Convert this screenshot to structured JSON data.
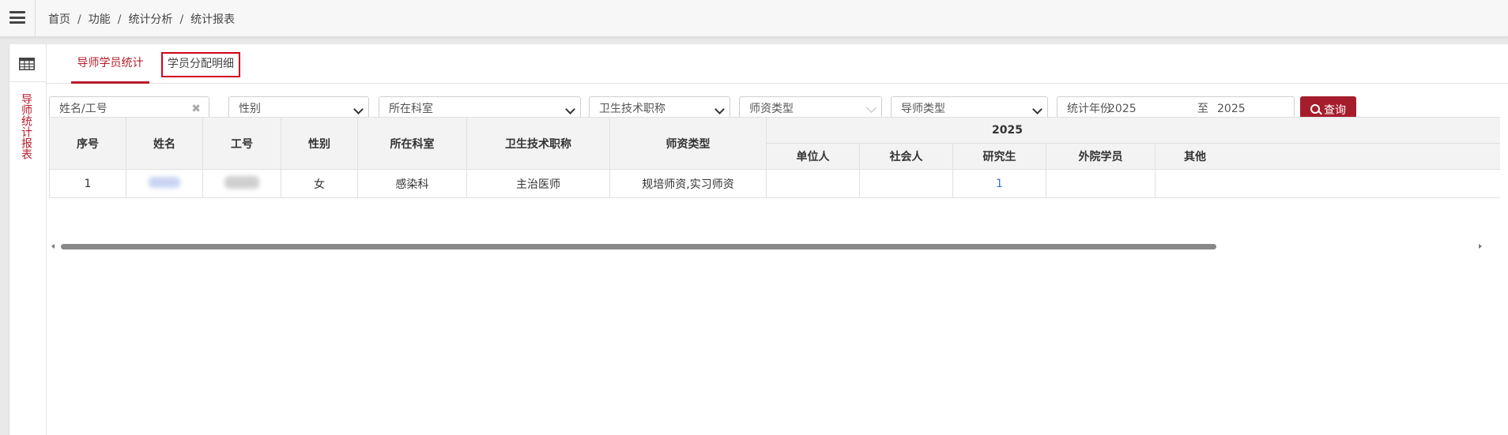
{
  "breadcrumb": [
    "首页",
    "功能",
    "统计分析",
    "统计报表"
  ],
  "sidebar": {
    "vertical_label": "导师统计报表"
  },
  "tabs": [
    {
      "label": "导师学员统计",
      "active": true
    },
    {
      "label": "学员分配明细",
      "active": false
    }
  ],
  "filters": {
    "name_placeholder": "姓名/工号",
    "gender": "性别",
    "department": "所在科室",
    "title": "卫生技术职称",
    "faculty_type": "师资类型",
    "mentor_type": "导师类型",
    "year_label": "统计年份",
    "year_from": "2025",
    "year_to_label": "至",
    "year_to": "2025",
    "query_button": "查询"
  },
  "table": {
    "headers": [
      "序号",
      "姓名",
      "工号",
      "性别",
      "所在科室",
      "卫生技术职称",
      "师资类型"
    ],
    "group_header": "2025",
    "sub_headers": [
      "单位人",
      "社会人",
      "研究生",
      "外院学员",
      "其他"
    ],
    "rows": [
      {
        "index": "1",
        "gender": "女",
        "department": "感染科",
        "title": "主治医师",
        "faculty_type": "规培师资,实习师资",
        "unit": "",
        "social": "",
        "graduate": "1",
        "external": "",
        "other": ""
      }
    ]
  },
  "colors": {
    "accent": "#b71c2c",
    "button": "#a51d2d",
    "link": "#3a6fd8"
  }
}
